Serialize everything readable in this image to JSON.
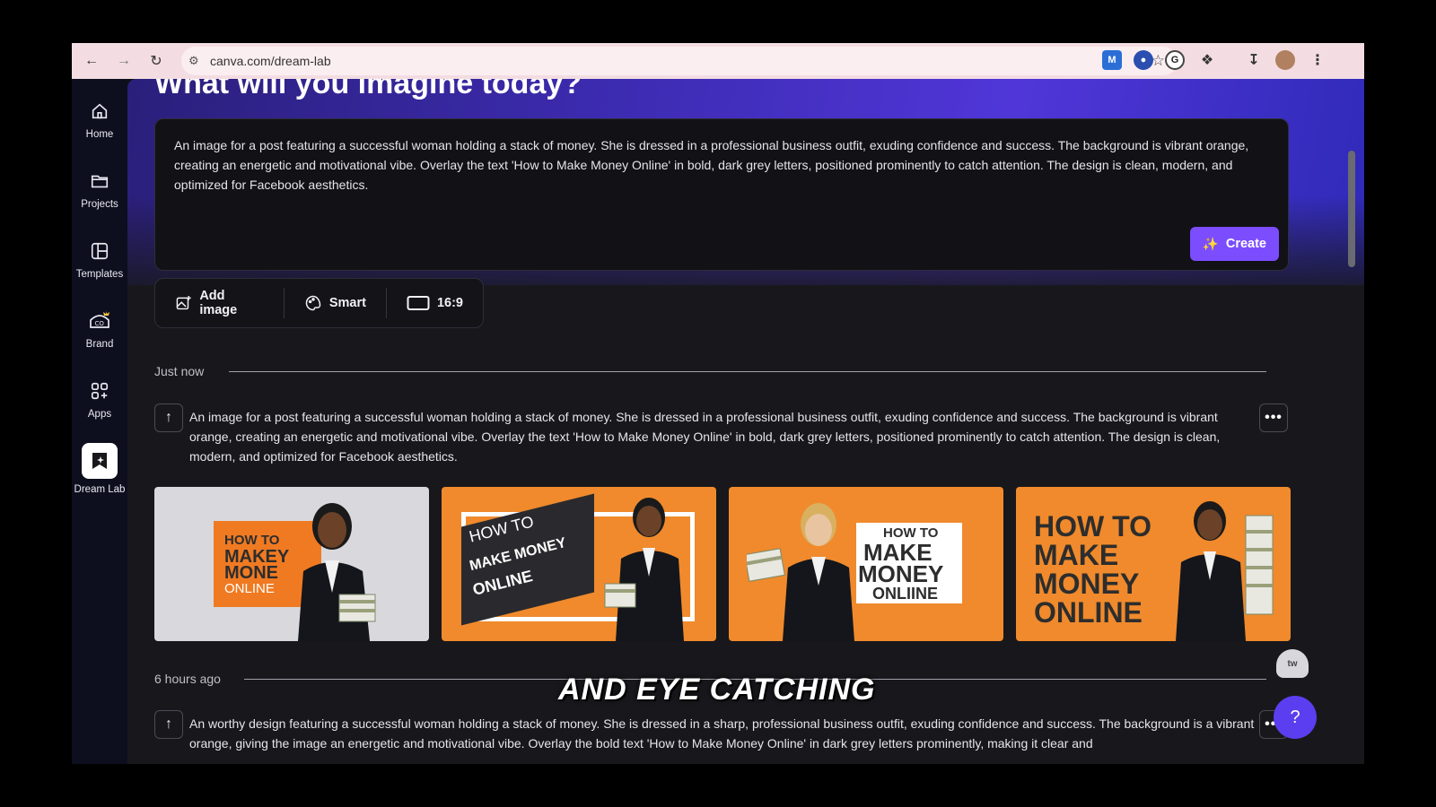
{
  "browser": {
    "url": "canva.com/dream-lab",
    "back_icon": "arrow-left-icon",
    "forward_icon": "arrow-right-icon",
    "reload_icon": "reload-icon"
  },
  "sidebar": {
    "items": [
      {
        "label": "Home",
        "icon": "home-icon"
      },
      {
        "label": "Projects",
        "icon": "folder-icon"
      },
      {
        "label": "Templates",
        "icon": "templates-icon"
      },
      {
        "label": "Brand",
        "icon": "brand-icon"
      },
      {
        "label": "Apps",
        "icon": "apps-icon"
      },
      {
        "label": "Dream Lab",
        "icon": "dream-lab-icon"
      }
    ]
  },
  "main": {
    "headline": "What will you imagine today?",
    "prompt": "An image for a post featuring a successful woman holding a stack of money. She is dressed in a professional business outfit, exuding confidence and success. The background is vibrant orange, creating an energetic and motivational vibe. Overlay the text 'How to Make Money Online' in bold, dark grey letters, positioned prominently to catch attention. The design is clean, modern, and optimized for Facebook aesthetics.",
    "create_label": "Create",
    "tools": [
      {
        "label": "Add image",
        "icon": "add-image-icon"
      },
      {
        "label": "Smart",
        "icon": "palette-icon"
      },
      {
        "label": "16:9",
        "icon": "aspect-ratio-icon"
      }
    ]
  },
  "history": [
    {
      "time": "Just now",
      "prompt": "An image for a post featuring a successful woman holding a stack of money. She is dressed in a professional business outfit, exuding confidence and success. The background is vibrant orange, creating an energetic and motivational vibe. Overlay the text 'How to Make Money Online' in bold, dark grey letters, positioned prominently to catch attention. The design is clean, modern, and optimized for Facebook aesthetics.",
      "images": [
        {
          "text_lines": [
            "HOW TO",
            "MAKEY",
            "MONE",
            "ONLINE"
          ]
        },
        {
          "text_lines": [
            "HOW TO",
            "MAKE MONEY",
            "ONLINE"
          ]
        },
        {
          "text_lines": [
            "HOW TO",
            "MAKE",
            "MONEY",
            "ONLIINE"
          ]
        },
        {
          "text_lines": [
            "HOW TO",
            "MAKE",
            "MONEY",
            "ONLINE"
          ]
        }
      ]
    },
    {
      "time": "6 hours ago",
      "prompt": "An worthy design featuring a successful woman holding a stack of money. She is dressed in a sharp, professional business outfit, exuding confidence and success. The background is a vibrant orange, giving the image an energetic and motivational vibe. Overlay the bold text 'How to Make Money Online' in dark grey letters prominently, making it clear and"
    }
  ],
  "overlay": {
    "caption": "AND EYE CATCHING",
    "help_label": "?",
    "ghost_label": "tw"
  },
  "colors": {
    "accent": "#7b4dff",
    "thumb_orange": "#f08a2c",
    "hero_purple": "#3d2cb3"
  }
}
